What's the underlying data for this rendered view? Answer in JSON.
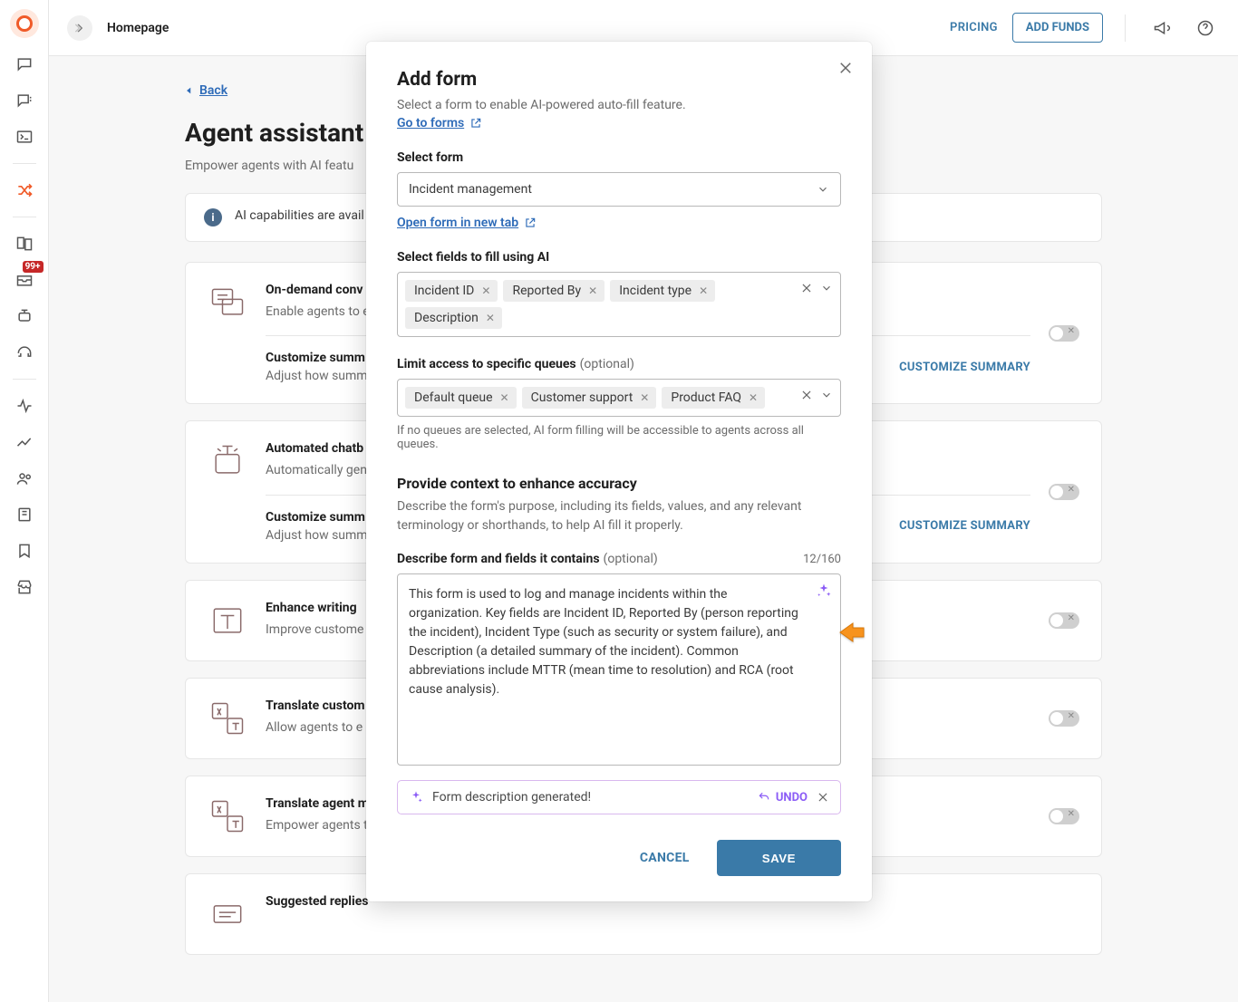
{
  "topbar": {
    "title": "Homepage",
    "pricing": "PRICING",
    "add_funds": "ADD FUNDS"
  },
  "rail": {
    "badge": "99+"
  },
  "page": {
    "back": "Back",
    "h1": "Agent assistant",
    "sub": "Empower agents with AI featu",
    "info": "AI capabilities are avail                                                                                                                                                             atact your account manager or our support team."
  },
  "cards": [
    {
      "title": "On-demand conv",
      "desc": "Enable agents to e                                                                                                                                                                                                               chatbot and agen",
      "sub_title": "Customize summ",
      "sub_desc": "Adjust how summ",
      "action": "CUSTOMIZE SUMMARY"
    },
    {
      "title": "Automated chatb",
      "desc": "Automatically gen                                                                                                                                                                                                               handoff. Chatbot s",
      "sub_title": "Customize summ",
      "sub_desc": "Adjust how summ",
      "action": "CUSTOMIZE SUMMARY"
    },
    {
      "title": "Enhance writing",
      "desc": "Improve custome                                                                                                                                                                                                               correcting gramm"
    },
    {
      "title": "Translate custom",
      "desc": "Allow agents to e                                                                                                                                                                                                               multilingual comm"
    },
    {
      "title": "Translate agent m",
      "desc": "Empower agents t                                                                                                                                                                                                               customers as nee"
    },
    {
      "title": "Suggested replies",
      "desc": ""
    }
  ],
  "modal": {
    "title": "Add form",
    "desc": "Select a form to enable AI-powered auto-fill feature.",
    "go_to_forms": "Go to forms",
    "select_form_label": "Select form",
    "selected_form": "Incident management",
    "open_form_new_tab": "Open form in new tab",
    "select_fields_label": "Select fields to fill using AI",
    "fields": [
      "Incident ID",
      "Reported By",
      "Incident type",
      "Description"
    ],
    "limit_queues_label": "Limit access to specific queues",
    "optional": "(optional)",
    "queues": [
      "Default queue",
      "Customer support",
      "Product FAQ"
    ],
    "queues_help": "If no queues are selected, AI form filling will be accessible to agents across all queues.",
    "context_hdr": "Provide context to enhance accuracy",
    "context_sub": "Describe the form's purpose, including its fields, values, and any relevant terminology or shorthands, to help AI fill it properly.",
    "describe_label": "Describe form and fields it contains",
    "counter": "12/160",
    "textarea_value": "This form is used to log and manage incidents within the organization. Key fields are Incident ID, Reported By (person reporting the incident), Incident Type (such as security or system failure), and Description (a detailed summary of the incident). Common abbreviations include MTTR (mean time to resolution) and RCA (root cause analysis).",
    "toast_text": "Form description generated!",
    "undo": "UNDO",
    "cancel": "CANCEL",
    "save": "SAVE"
  }
}
